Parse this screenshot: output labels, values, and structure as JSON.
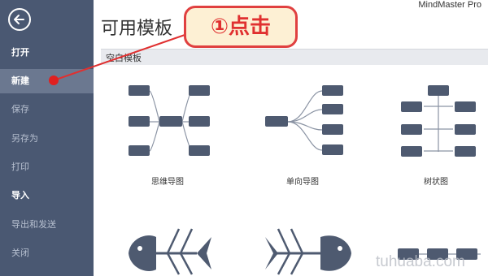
{
  "app": {
    "name": "MindMaster Pro"
  },
  "sidebar": {
    "items": [
      {
        "label": "打开"
      },
      {
        "label": "新建"
      },
      {
        "label": "保存"
      },
      {
        "label": "另存为"
      },
      {
        "label": "打印"
      },
      {
        "label": "导入"
      },
      {
        "label": "导出和发送"
      },
      {
        "label": "关闭"
      }
    ]
  },
  "main": {
    "title": "可用模板",
    "section": "空白模板",
    "templates": [
      {
        "label": "思维导图"
      },
      {
        "label": "单向导图"
      },
      {
        "label": "树状图"
      }
    ]
  },
  "annotation": {
    "callout": "①点击"
  },
  "watermark": "tuhuaba.com",
  "colors": {
    "sidebar": "#4a5872",
    "node": "#4e5a70",
    "accent": "#e03030"
  }
}
